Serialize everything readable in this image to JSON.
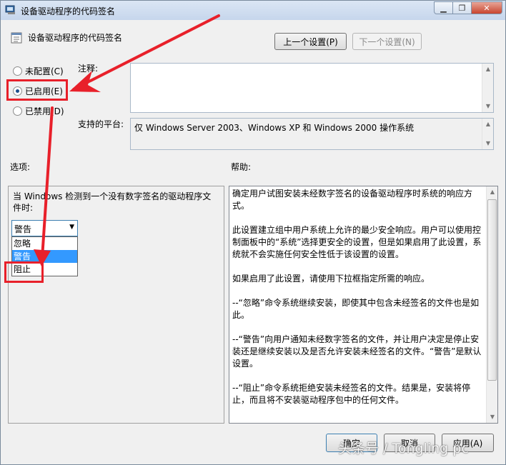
{
  "window": {
    "title": "设备驱动程序的代码签名",
    "policy_icon": "policy-icon",
    "controls": [
      "minimize-icon",
      "restore-icon",
      "close-icon"
    ]
  },
  "header": {
    "policy_name": "设备驱动程序的代码签名",
    "prev_button": "上一个设置(P)",
    "next_button": "下一个设置(N)"
  },
  "state": {
    "not_configured": "未配置(C)",
    "enabled": "已启用(E)",
    "disabled": "已禁用(D)",
    "selected": "enabled"
  },
  "comment": {
    "label": "注释:",
    "value": ""
  },
  "platform": {
    "label": "支持的平台:",
    "value": "仅 Windows Server 2003、Windows XP 和 Windows 2000 操作系统"
  },
  "options": {
    "label": "选项:",
    "description": "当 Windows 检测到一个没有数字签名的驱动程序文件时:",
    "dropdown_value": "警告",
    "dropdown_items": [
      "忽略",
      "警告",
      "阻止"
    ],
    "highlighted_item": "警告"
  },
  "help": {
    "label": "帮助:",
    "paragraphs": [
      "确定用户试图安装未经数字签名的设备驱动程序时系统的响应方式。",
      "此设置建立组中用户系统上允许的最少安全响应。用户可以使用控制面板中的“系统”选择更安全的设置，但是如果启用了此设置，系统就不会实施任何安全性低于该设置的设置。",
      "如果启用了此设置，请使用下拉框指定所需的响应。",
      "--“忽略”命令系统继续安装，即使其中包含未经签名的文件也是如此。",
      "--“警告”向用户通知未经数字签名的文件，并让用户决定是停止安装还是继续安装以及是否允许安装未经签名的文件。“警告”是默认设置。",
      "--“阻止”命令系统拒绝安装未经签名的文件。结果是，安装将停止，而且将不安装驱动程序包中的任何文件。"
    ]
  },
  "footer": {
    "ok": "确定",
    "cancel": "取消",
    "apply": "应用(A)"
  },
  "watermark": "头条号 / Tongling pc",
  "colors": {
    "annotation_red": "#e8202a",
    "selection_blue": "#3399ff"
  }
}
